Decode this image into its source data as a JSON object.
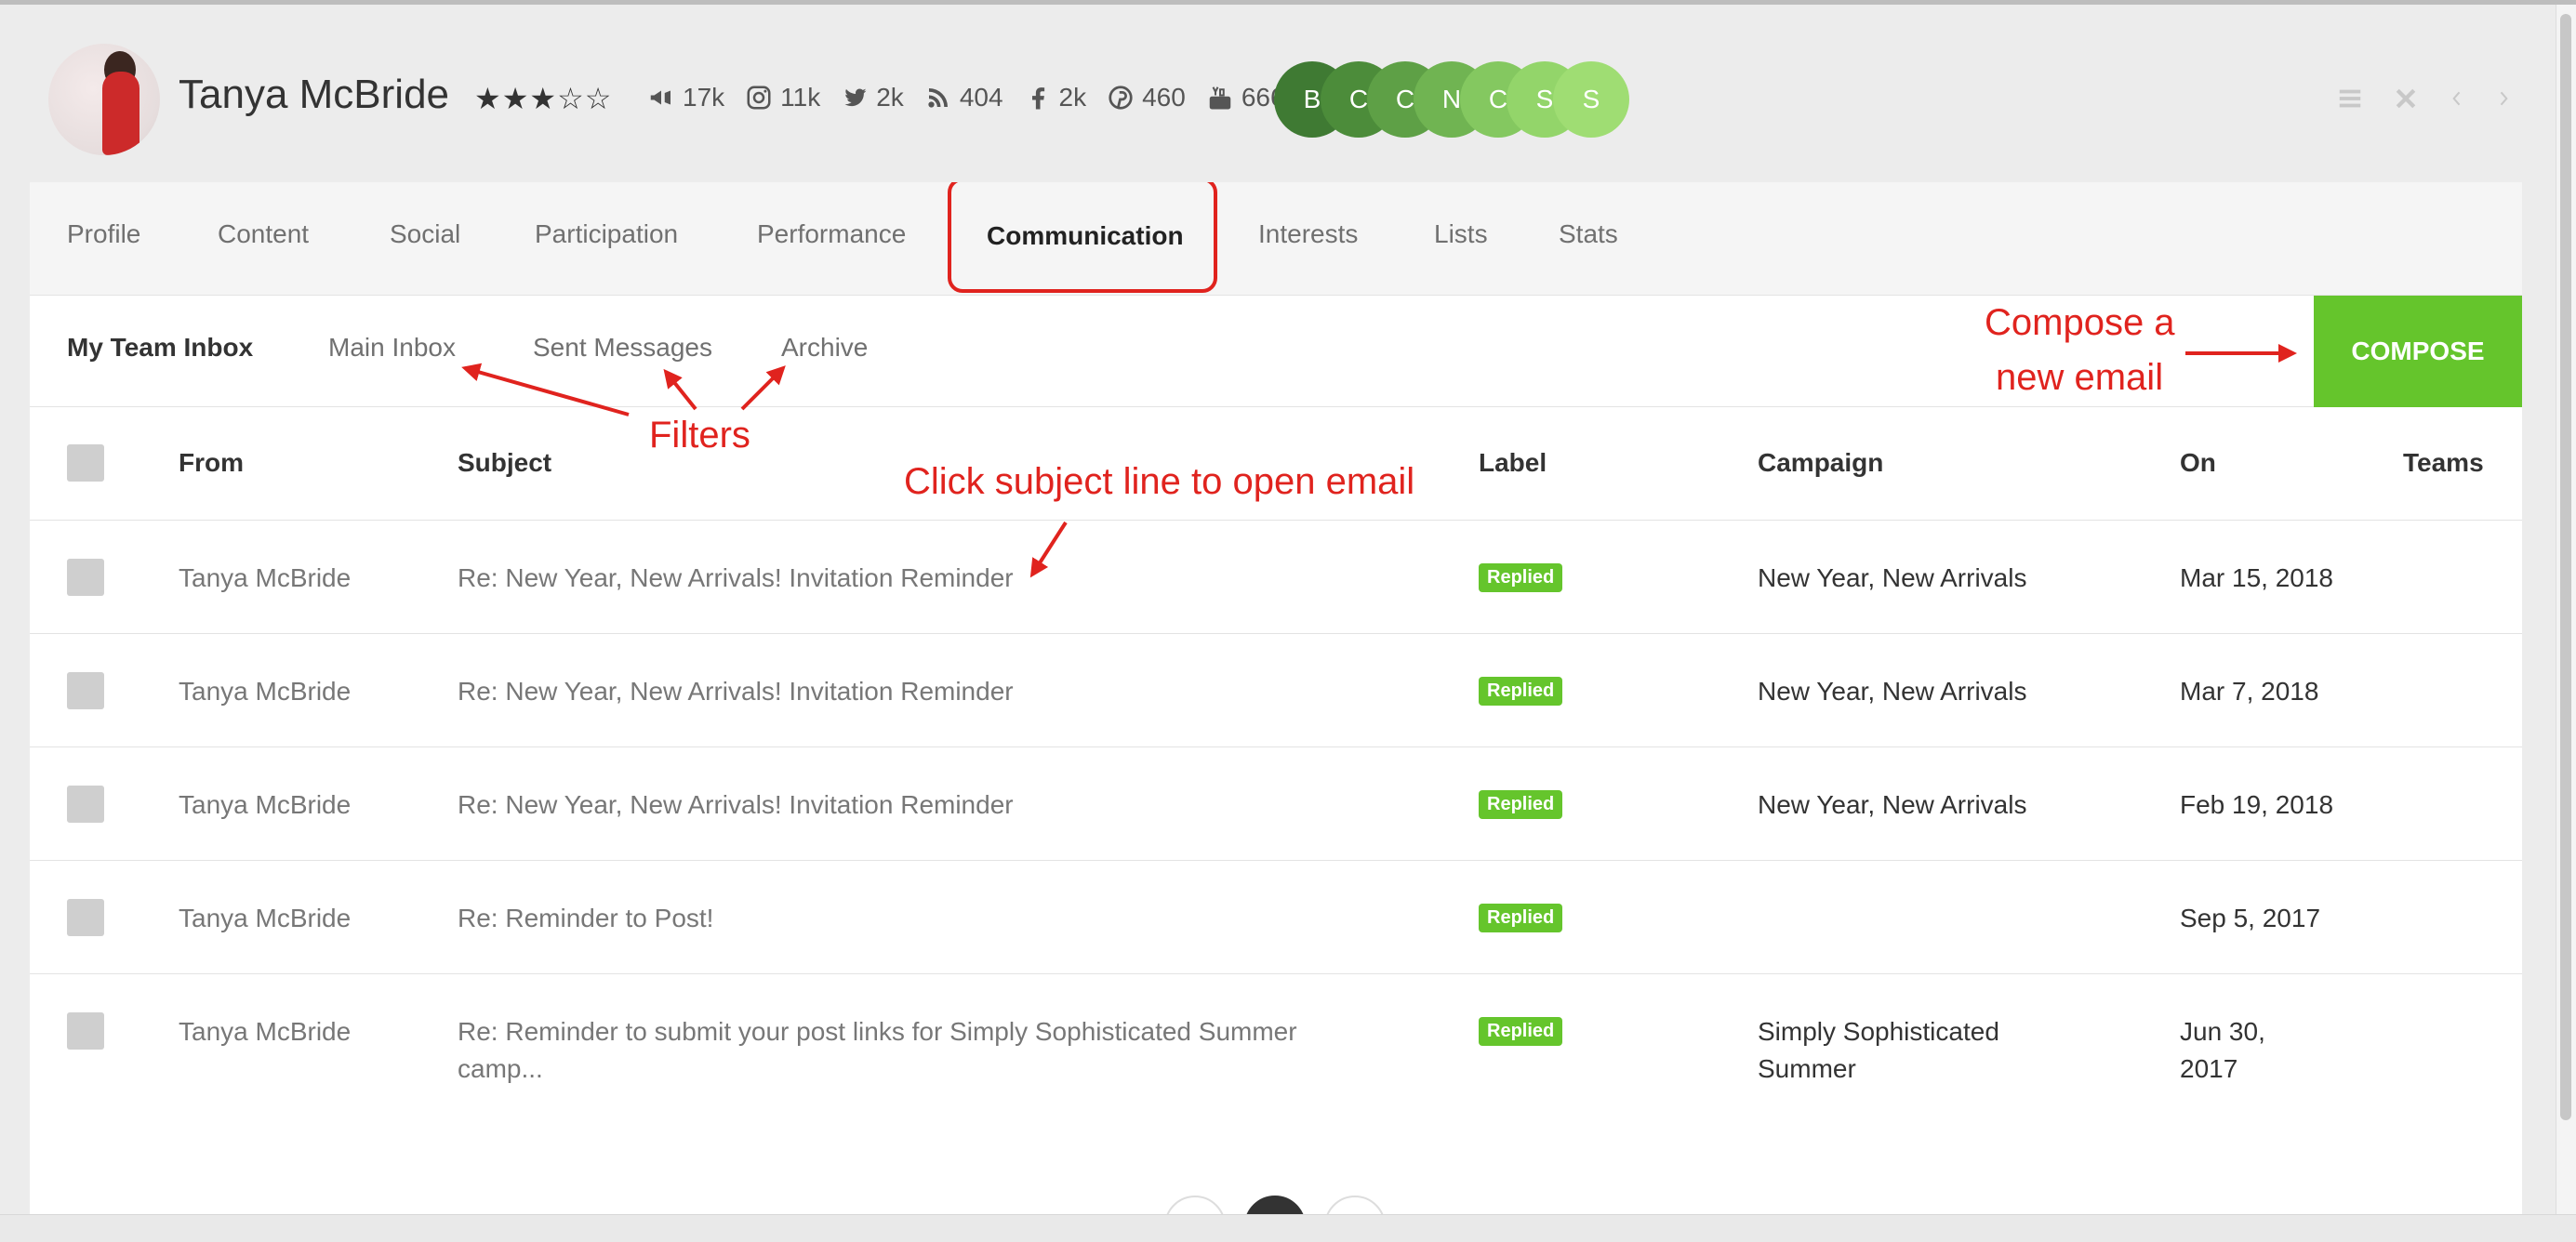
{
  "profile": {
    "name": "Tanya McBride",
    "rating": 3,
    "rating_max": 5,
    "stars": "★★★☆☆",
    "socials": [
      {
        "icon": "megaphone-icon",
        "value": "17k"
      },
      {
        "icon": "instagram-icon",
        "value": "11k"
      },
      {
        "icon": "twitter-icon",
        "value": "2k"
      },
      {
        "icon": "rss-icon",
        "value": "404"
      },
      {
        "icon": "facebook-icon",
        "value": "2k"
      },
      {
        "icon": "pinterest-icon",
        "value": "460"
      },
      {
        "icon": "youtube-icon",
        "value": "666"
      }
    ],
    "badges": [
      {
        "letter": "B",
        "color": "#3f7a33"
      },
      {
        "letter": "C",
        "color": "#4c8c3a"
      },
      {
        "letter": "C",
        "color": "#5ea046"
      },
      {
        "letter": "N",
        "color": "#70b452"
      },
      {
        "letter": "C",
        "color": "#84c860"
      },
      {
        "letter": "S",
        "color": "#93d56a"
      },
      {
        "letter": "S",
        "color": "#9fdd73"
      }
    ]
  },
  "window_controls": [
    "menu-icon",
    "close-icon",
    "chevron-left-icon",
    "chevron-right-icon"
  ],
  "tabs": [
    "Profile",
    "Content",
    "Social",
    "Participation",
    "Performance",
    "Communication",
    "Interests",
    "Lists",
    "Stats"
  ],
  "active_tab": "Communication",
  "inbox": {
    "title": "My Team Inbox",
    "filters": [
      "Main Inbox",
      "Sent Messages",
      "Archive"
    ],
    "compose_label": "COMPOSE"
  },
  "table": {
    "headers": [
      "From",
      "Subject",
      "Label",
      "Campaign",
      "On",
      "Teams"
    ],
    "rows": [
      {
        "from": "Tanya McBride",
        "subject": "Re: New Year, New Arrivals! Invitation Reminder",
        "label": "Replied",
        "campaign": "New Year, New Arrivals",
        "on": "Mar 15, 2018",
        "teams": ""
      },
      {
        "from": "Tanya McBride",
        "subject": "Re: New Year, New Arrivals! Invitation Reminder",
        "label": "Replied",
        "campaign": "New Year, New Arrivals",
        "on": "Mar 7, 2018",
        "teams": ""
      },
      {
        "from": "Tanya McBride",
        "subject": "Re: New Year, New Arrivals! Invitation Reminder",
        "label": "Replied",
        "campaign": "New Year, New Arrivals",
        "on": "Feb 19, 2018",
        "teams": ""
      },
      {
        "from": "Tanya McBride",
        "subject": "Re: Reminder to Post!",
        "label": "Replied",
        "campaign": "",
        "on": "Sep 5, 2017",
        "teams": ""
      },
      {
        "from": "Tanya McBride",
        "subject_line1": "Re: Reminder to submit your post links for Simply Sophisticated Summer",
        "subject_line2": "camp...",
        "label": "Replied",
        "campaign_line1": "Simply Sophisticated",
        "campaign_line2": "Summer",
        "on_line1": "Jun 30,",
        "on_line2": "2017",
        "teams": ""
      }
    ]
  },
  "annotations": {
    "compose_line1": "Compose a",
    "compose_line2": "new email",
    "filters": "Filters",
    "subject_hint": "Click subject line to open email"
  },
  "colors": {
    "accent_green": "#65c52c",
    "annotation_red": "#e0231e"
  }
}
